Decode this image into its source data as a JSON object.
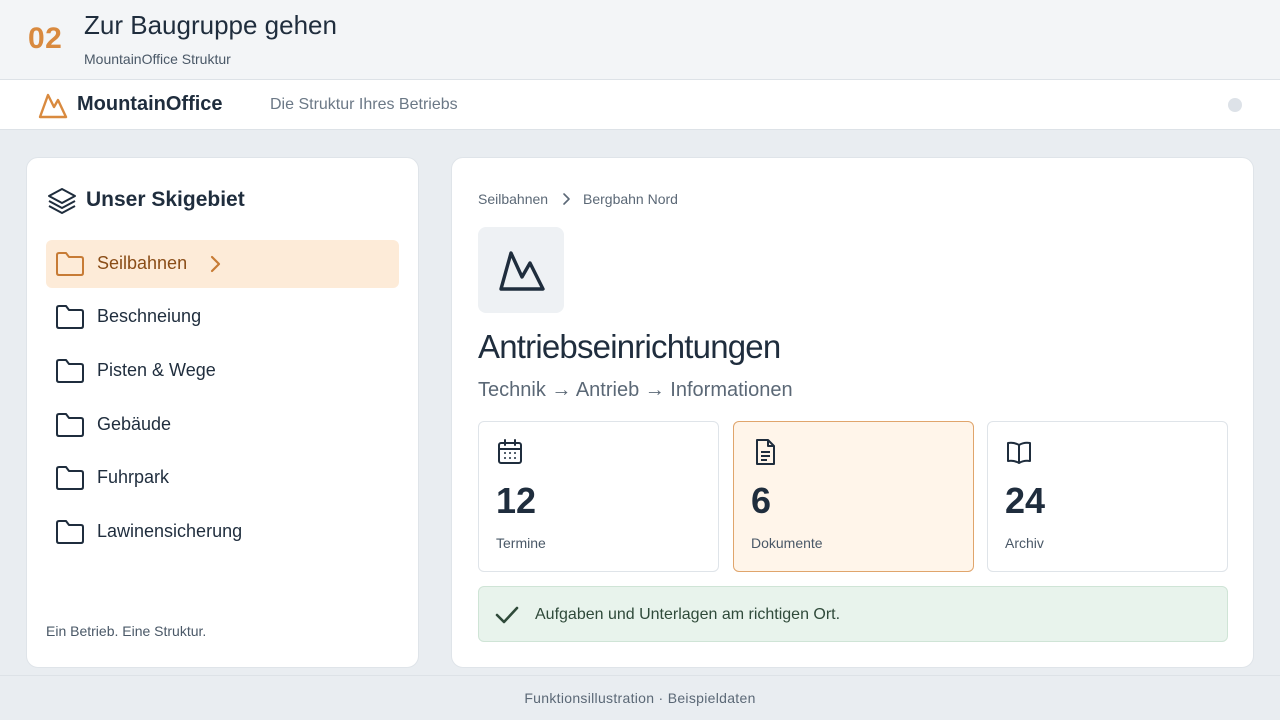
{
  "step": {
    "number": "02",
    "title": "Zur Baugruppe gehen",
    "subtitle": "MountainOffice Struktur"
  },
  "app": {
    "brand": "MountainOffice",
    "tagline": "Die Struktur Ihres Betriebs",
    "accent_color": "#d98a3f"
  },
  "sidebar": {
    "title": "Unser Skigebiet",
    "items": [
      {
        "label": "Seilbahnen",
        "active": true
      },
      {
        "label": "Beschneiung"
      },
      {
        "label": "Pisten & Wege"
      },
      {
        "label": "Gebäude"
      },
      {
        "label": "Fuhrpark"
      },
      {
        "label": "Lawinensicherung"
      }
    ],
    "footer": "Ein Betrieb. Eine Struktur."
  },
  "main": {
    "breadcrumb": [
      "Seilbahnen",
      "Bergbahn Nord"
    ],
    "title": "Antriebseinrichtungen",
    "path": "Technik → Antrieb → Informationen",
    "stats": [
      {
        "icon": "calendar-icon",
        "value": "12",
        "label": "Termine"
      },
      {
        "icon": "document-icon",
        "value": "6",
        "label": "Dokumente",
        "highlight": true
      },
      {
        "icon": "book-icon",
        "value": "24",
        "label": "Archiv"
      }
    ],
    "notice": "Aufgaben und Unterlagen am richtigen Ort."
  },
  "footer": "Funktionsillustration · Beispieldaten"
}
